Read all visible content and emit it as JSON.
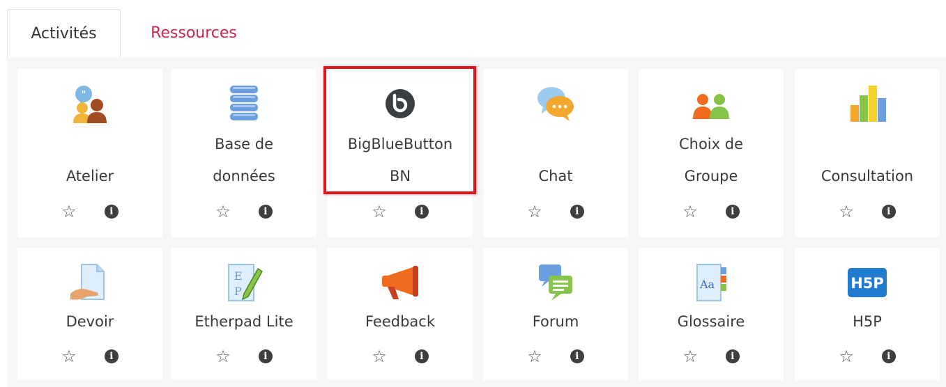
{
  "tabs": [
    {
      "label": "Activités",
      "active": true
    },
    {
      "label": "Ressources",
      "active": false
    }
  ],
  "colors": {
    "tab_inactive": "#c7264d",
    "panel_bg": "#f7f7f9",
    "highlight": "#e2141c"
  },
  "activities": [
    {
      "lines": [
        "Atelier"
      ],
      "icon": "workshop-icon",
      "highlighted": false
    },
    {
      "lines": [
        "Base de",
        "données"
      ],
      "icon": "database-icon",
      "highlighted": false
    },
    {
      "lines": [
        "BigBlueButton",
        "BN"
      ],
      "icon": "bigbluebutton-icon",
      "highlighted": true
    },
    {
      "lines": [
        "Chat"
      ],
      "icon": "chat-icon",
      "highlighted": false
    },
    {
      "lines": [
        "Choix de",
        "Groupe"
      ],
      "icon": "group-choice-icon",
      "highlighted": false
    },
    {
      "lines": [
        "Consultation"
      ],
      "icon": "survey-icon",
      "highlighted": false
    },
    {
      "lines": [
        "Devoir"
      ],
      "icon": "assignment-icon",
      "highlighted": false
    },
    {
      "lines": [
        "Etherpad Lite"
      ],
      "icon": "etherpad-icon",
      "highlighted": false
    },
    {
      "lines": [
        "Feedback"
      ],
      "icon": "feedback-icon",
      "highlighted": false
    },
    {
      "lines": [
        "Forum"
      ],
      "icon": "forum-icon",
      "highlighted": false
    },
    {
      "lines": [
        "Glossaire"
      ],
      "icon": "glossary-icon",
      "highlighted": false
    },
    {
      "lines": [
        "H5P"
      ],
      "icon": "h5p-icon",
      "highlighted": false
    }
  ],
  "actions": {
    "star": "☆",
    "info": "i"
  },
  "h5p_logo_text": "H5P"
}
